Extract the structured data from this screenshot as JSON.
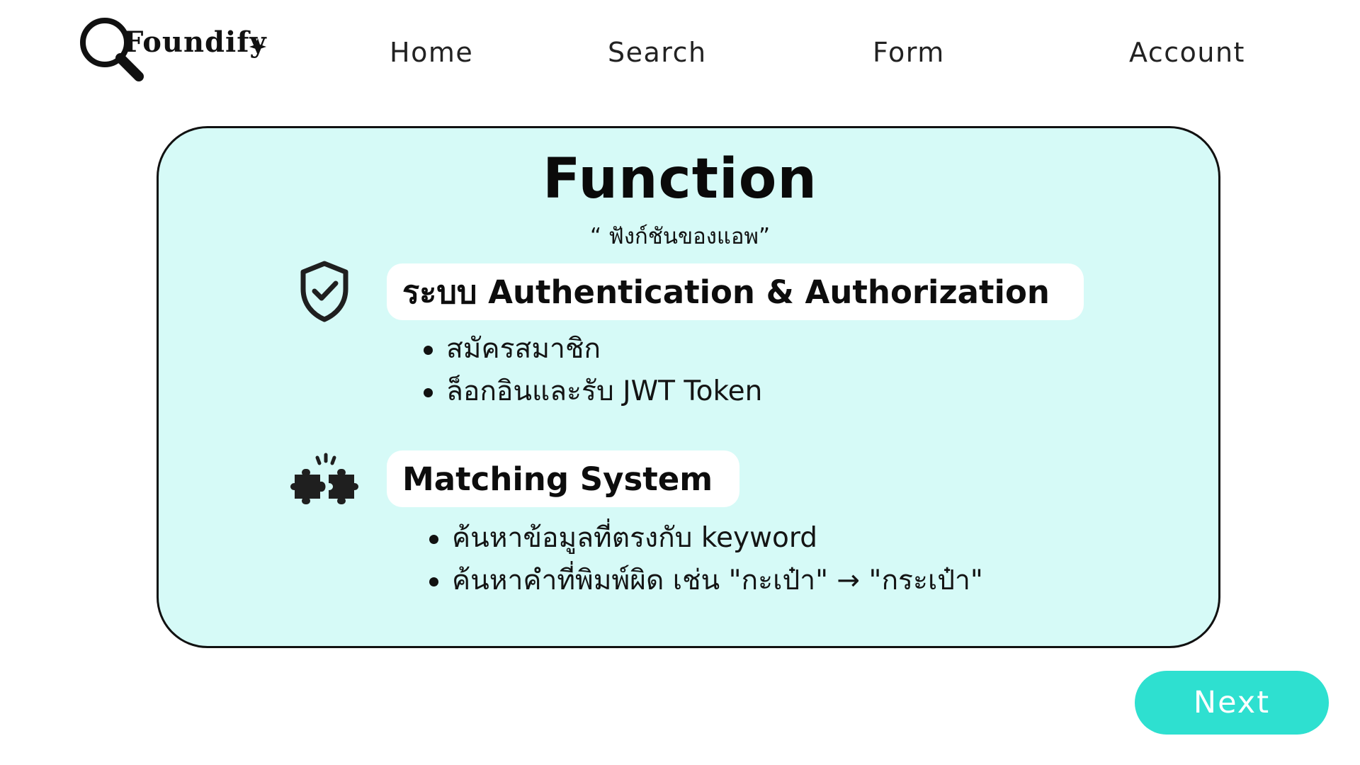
{
  "logo": {
    "text": "Foundify"
  },
  "nav": {
    "home": "Home",
    "search": "Search",
    "form": "Form",
    "account": "Account"
  },
  "card": {
    "title": "Function",
    "subtitle": "“ ฟังก์ชันของแอพ”",
    "sections": [
      {
        "icon": "shield-check-icon",
        "heading": "ระบบ Authentication & Authorization",
        "items": [
          "สมัครสมาชิก",
          "ล็อกอินและรับ JWT Token"
        ]
      },
      {
        "icon": "puzzle-icon",
        "heading": "Matching System",
        "items": [
          "ค้นหาข้อมูลที่ตรงกับ keyword",
          "ค้นหาคำที่พิมพ์ผิด เช่น \"กะเป๋า\" → \"กระเป๋า\""
        ]
      }
    ]
  },
  "next": {
    "label": "Next"
  },
  "colors": {
    "card_background": "#d6faf7",
    "accent": "#2ee0d0",
    "text": "#111111"
  }
}
